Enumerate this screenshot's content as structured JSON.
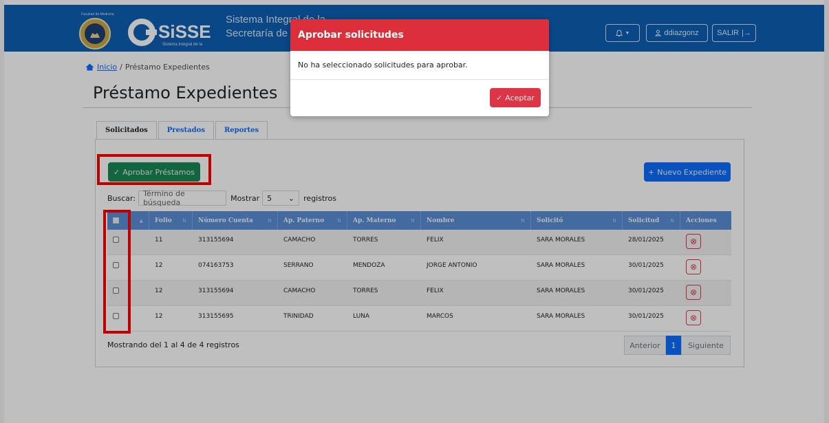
{
  "header": {
    "faculty": "Facultad de Medicina",
    "brand": "SiSSE",
    "brand_tagline": "Sistema Integral de la",
    "subtitle_line1": "Sistema Integral de la",
    "subtitle_line2": "Secretaría de Servicios",
    "notifications_icon": "bell-icon",
    "user": "ddiazgonz",
    "logout": "SALIR"
  },
  "breadcrumb": {
    "home": "Inicio",
    "separator": "/",
    "current": "Préstamo Expedientes"
  },
  "page_title": "Préstamo Expedientes",
  "tabs": [
    {
      "label": "Solicitados",
      "active": true
    },
    {
      "label": "Prestados",
      "active": false
    },
    {
      "label": "Reportes",
      "active": false
    }
  ],
  "toolbar": {
    "approve_label": "Aprobar Préstamos",
    "new_label": "Nuevo Expediente"
  },
  "search": {
    "label": "Buscar:",
    "placeholder": "Término de búsqueda",
    "show_label": "Mostrar",
    "page_size": "5",
    "records_label": "registros"
  },
  "table": {
    "headers": [
      "Folio",
      "Número Cuenta",
      "Ap. Paterno",
      "Ap. Materno",
      "Nombre",
      "Solicitó",
      "Solicitud",
      "Acciones"
    ],
    "rows": [
      {
        "folio": "11",
        "cuenta": "313155694",
        "paterno": "CAMACHO",
        "materno": "TORRES",
        "nombre": "FELIX",
        "solicito": "SARA MORALES",
        "fecha": "28/01/2025"
      },
      {
        "folio": "12",
        "cuenta": "074163753",
        "paterno": "SERRANO",
        "materno": "MENDOZA",
        "nombre": "JORGE ANTONIO",
        "solicito": "SARA MORALES",
        "fecha": "30/01/2025"
      },
      {
        "folio": "12",
        "cuenta": "313155694",
        "paterno": "CAMACHO",
        "materno": "TORRES",
        "nombre": "FELIX",
        "solicito": "SARA MORALES",
        "fecha": "30/01/2025"
      },
      {
        "folio": "12",
        "cuenta": "313155695",
        "paterno": "TRINIDAD",
        "materno": "LUNA",
        "nombre": "MARCOS",
        "solicito": "SARA MORALES",
        "fecha": "30/01/2025"
      }
    ]
  },
  "footer": {
    "info": "Mostrando del 1 al 4 de 4 registros"
  },
  "pagination": {
    "prev": "Anterior",
    "current": "1",
    "next": "Siguiente"
  },
  "modal": {
    "title": "Aprobar solicitudes",
    "message": "No ha seleccionado solicitudes para aprobar.",
    "accept": "Aceptar"
  },
  "colors": {
    "navbar": "#0d5fb5",
    "modal_header": "#dc2f3b",
    "success": "#198754",
    "primary": "#0d6efd",
    "table_header": "#5b8fd6",
    "highlight": "#ff0000"
  }
}
